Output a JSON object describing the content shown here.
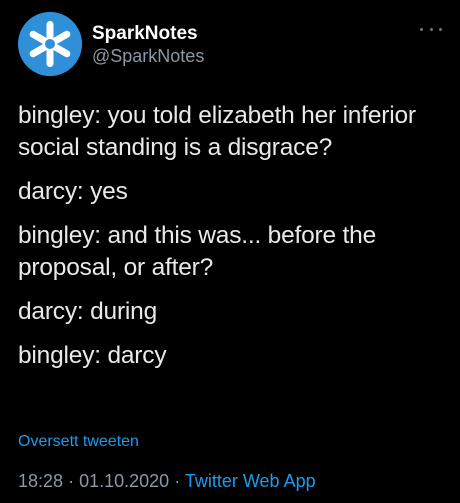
{
  "author": {
    "display_name": "SparkNotes",
    "handle": "@SparkNotes",
    "avatar_icon": "sparknotes-logo-icon",
    "avatar_color": "#2f8fd8"
  },
  "menu": {
    "icon": "more-icon"
  },
  "tweet": {
    "paragraphs": [
      "bingley: you told elizabeth her inferior social standing is a disgrace?",
      "darcy: yes",
      "bingley: and this was... before the proposal, or after?",
      "darcy: during",
      "bingley: darcy"
    ],
    "translate_label": "Oversett tweeten",
    "time": "18:28",
    "date": "01.10.2020",
    "separator": "·",
    "source": "Twitter Web App"
  },
  "colors": {
    "background": "#000000",
    "accent": "#1d9bf0",
    "secondary_text": "#8b98a5"
  }
}
